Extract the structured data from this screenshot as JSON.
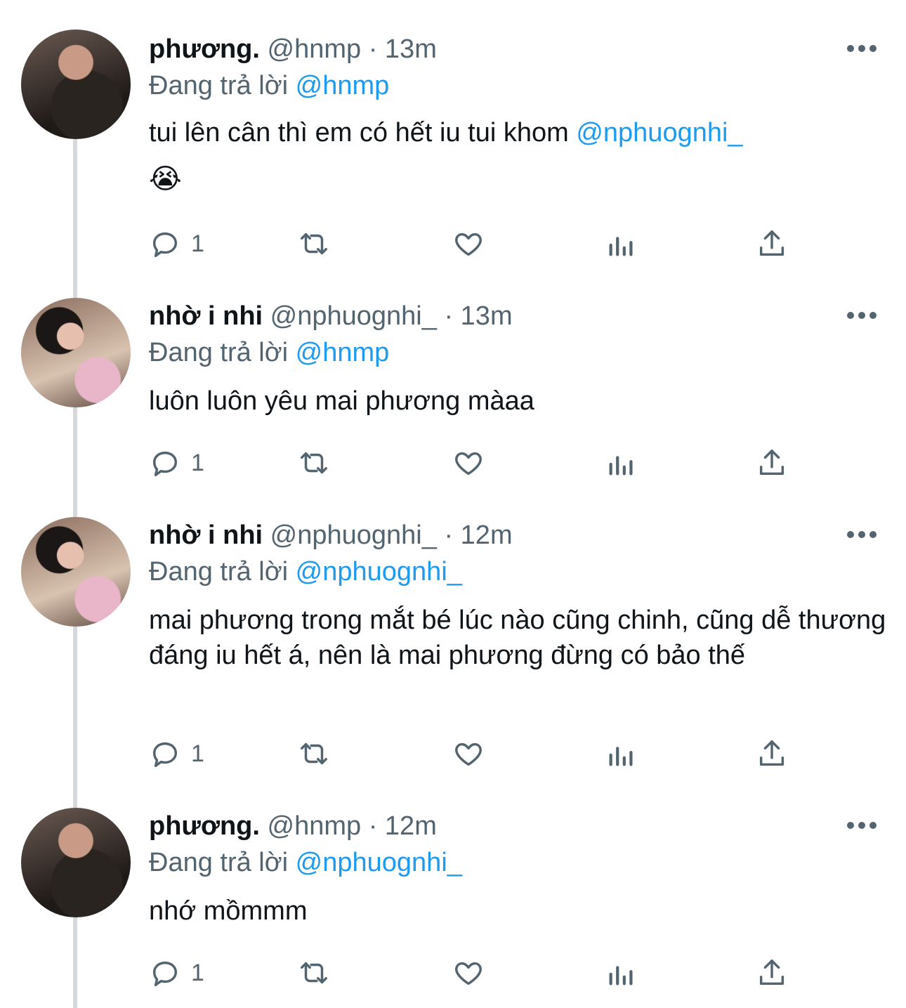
{
  "tweets": [
    {
      "name": "phương.",
      "handle": "@hnmp",
      "time": "13m",
      "reply_prefix": "Đang trả lời",
      "reply_to": "@hnmp",
      "text": "tui lên cân thì em có hết iu tui khom",
      "text_mention": "@nphuognhi_",
      "emoji": "😭",
      "reply_count": "1"
    },
    {
      "name": "nhờ i nhi",
      "handle": "@nphuognhi_",
      "time": "13m",
      "reply_prefix": "Đang trả lời",
      "reply_to": "@hnmp",
      "text": "luôn luôn yêu mai phương màaa",
      "reply_count": "1"
    },
    {
      "name": "nhờ i nhi",
      "handle": "@nphuognhi_",
      "time": "12m",
      "reply_prefix": "Đang trả lời",
      "reply_to": "@nphuognhi_",
      "text": "mai phương trong mắt bé lúc nào cũng chinh, cũng dễ thương đáng iu hết á, nên là mai phương đừng có bảo thế",
      "reply_count": "1"
    },
    {
      "name": "phương.",
      "handle": "@hnmp",
      "time": "12m",
      "reply_prefix": "Đang trả lời",
      "reply_to": "@nphuognhi_",
      "text": "nhớ mồmmm",
      "reply_count": "1"
    }
  ],
  "separator": "·",
  "icons": [
    "reply-icon",
    "retweet-icon",
    "like-icon",
    "analytics-icon",
    "share-icon",
    "more-icon"
  ],
  "colors": {
    "link": "#1d9bf0",
    "muted": "#536471",
    "text": "#0f1419",
    "thread_line": "#d6d9dc"
  }
}
